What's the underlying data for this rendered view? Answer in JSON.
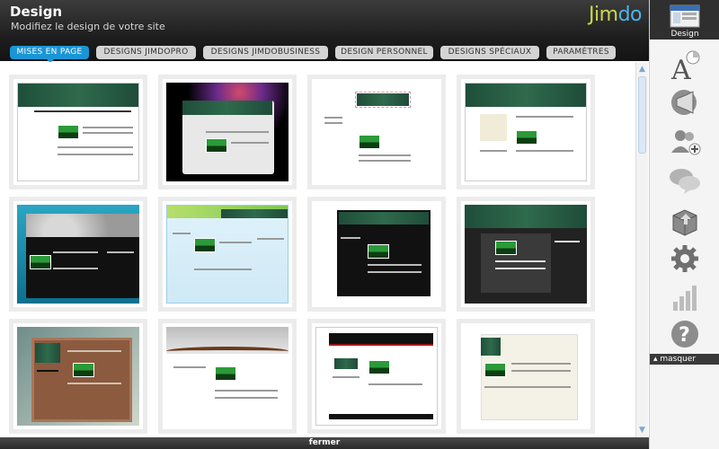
{
  "header": {
    "title": "Design",
    "subtitle": "Modifiez le design de votre site",
    "logo_part1": "Jim",
    "logo_part2": "do"
  },
  "tabs": [
    {
      "label": "MISES EN PAGE",
      "active": true
    },
    {
      "label": "DESIGNS JIMDOPRO",
      "active": false
    },
    {
      "label": "DESIGNS JIMDOBUSINESS",
      "active": false
    },
    {
      "label": "DESIGN PERSONNEL",
      "active": false
    },
    {
      "label": "DESIGNS SPÉCIAUX",
      "active": false
    },
    {
      "label": "PARAMÈTRES",
      "active": false
    }
  ],
  "layouts": {
    "count": 12,
    "rows": 3,
    "columns": 4
  },
  "footer": {
    "close_label": "fermer"
  },
  "sidebar": {
    "items": [
      {
        "label": "Design",
        "icon": "design-icon",
        "active": true
      },
      {
        "label": "",
        "icon": "font-style-icon"
      },
      {
        "label": "",
        "icon": "megaphone-icon"
      },
      {
        "label": "",
        "icon": "user-add-icon"
      },
      {
        "label": "",
        "icon": "chat-bubbles-icon"
      },
      {
        "label": "",
        "icon": "package-box-icon"
      },
      {
        "label": "",
        "icon": "gear-icon"
      },
      {
        "label": "",
        "icon": "statistics-bars-icon"
      },
      {
        "label": "",
        "icon": "help-icon"
      }
    ],
    "hide_label": "masquer"
  },
  "colors": {
    "accent": "#1b95d6",
    "header_bg": "#1e1e1e",
    "logo_green": "#c9d84f",
    "logo_blue": "#4fb3e8"
  }
}
